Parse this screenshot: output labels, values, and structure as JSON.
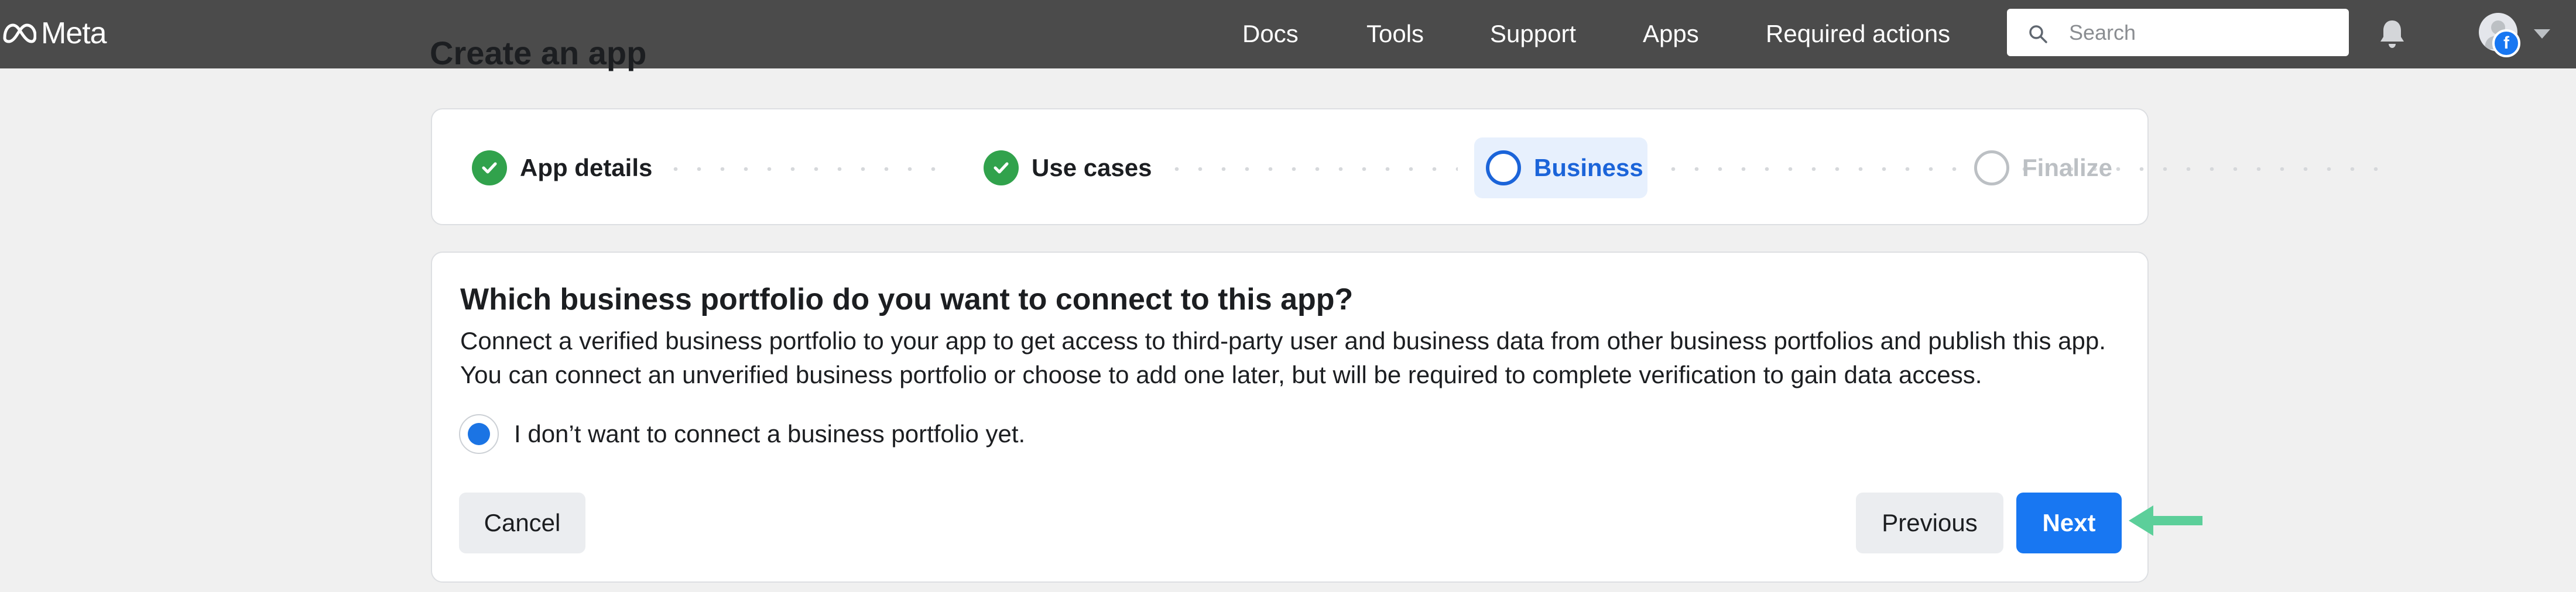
{
  "header": {
    "brand": "Meta",
    "nav": [
      "Docs",
      "Tools",
      "Support",
      "Apps",
      "Required actions"
    ],
    "search_placeholder": "Search",
    "icons": [
      "meta-logo-icon",
      "search-icon",
      "bell-icon",
      "avatar",
      "facebook-badge-icon",
      "chevron-down-icon"
    ]
  },
  "page": {
    "title": "Create an app"
  },
  "stepper": {
    "steps": [
      {
        "label": "App details",
        "state": "complete"
      },
      {
        "label": "Use cases",
        "state": "complete"
      },
      {
        "label": "Business",
        "state": "current"
      },
      {
        "label": "Finalize",
        "state": "upcoming"
      }
    ]
  },
  "business": {
    "heading": "Which business portfolio do you want to connect to this app?",
    "description": "Connect a verified business portfolio to your app to get access to third-party user and business data from other business portfolios and publish this app. You can connect an unverified business portfolio or choose to add one later, but will be required to complete verification to gain data access.",
    "option_label": "I don’t want to connect a business portfolio yet.",
    "option_selected": true
  },
  "actions": {
    "cancel": "Cancel",
    "previous": "Previous",
    "next": "Next"
  },
  "colors": {
    "topbar": "#4b4b4b",
    "accent": "#1877f2",
    "success": "#31a24c",
    "pointer_arrow": "#5ccf9a"
  }
}
